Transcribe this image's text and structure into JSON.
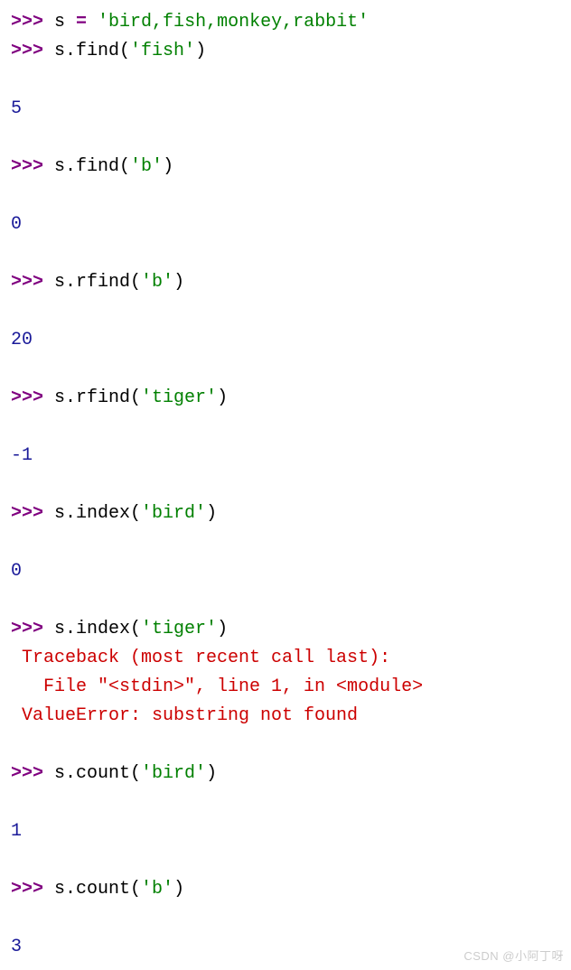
{
  "lines": {
    "l1_prompt": ">>> ",
    "l1_var": "s ",
    "l1_op": "= ",
    "l1_str": "'bird,fish,monkey,rabbit'",
    "l2_prompt": ">>> ",
    "l2_expr_a": "s",
    "l2_expr_b": ".find(",
    "l2_str": "'fish'",
    "l2_expr_c": ")",
    "l3_out": "5",
    "l4_prompt": ">>> ",
    "l4_expr_a": "s",
    "l4_expr_b": ".find(",
    "l4_str": "'b'",
    "l4_expr_c": ")",
    "l5_out": "0",
    "l6_prompt": ">>> ",
    "l6_expr_a": "s",
    "l6_expr_b": ".rfind(",
    "l6_str": "'b'",
    "l6_expr_c": ")",
    "l7_out": "20",
    "l8_prompt": ">>> ",
    "l8_expr_a": "s",
    "l8_expr_b": ".rfind(",
    "l8_str": "'tiger'",
    "l8_expr_c": ")",
    "l9_out": "-1",
    "l10_prompt": ">>> ",
    "l10_expr_a": "s",
    "l10_expr_b": ".index(",
    "l10_str": "'bird'",
    "l10_expr_c": ")",
    "l11_out": "0",
    "l12_prompt": ">>> ",
    "l12_expr_a": "s",
    "l12_expr_b": ".index(",
    "l12_str": "'tiger'",
    "l12_expr_c": ")",
    "err1": " Traceback (most recent call last):",
    "err2": "   File \"<stdin>\", line 1, in <module>",
    "err3": " ValueError: substring not found",
    "l14_prompt": ">>> ",
    "l14_expr_a": "s",
    "l14_expr_b": ".count(",
    "l14_str": "'bird'",
    "l14_expr_c": ")",
    "l15_out": "1",
    "l16_prompt": ">>> ",
    "l16_expr_a": "s",
    "l16_expr_b": ".count(",
    "l16_str": "'b'",
    "l16_expr_c": ")",
    "l17_out": "3"
  },
  "watermark": "CSDN @小阿丁呀"
}
